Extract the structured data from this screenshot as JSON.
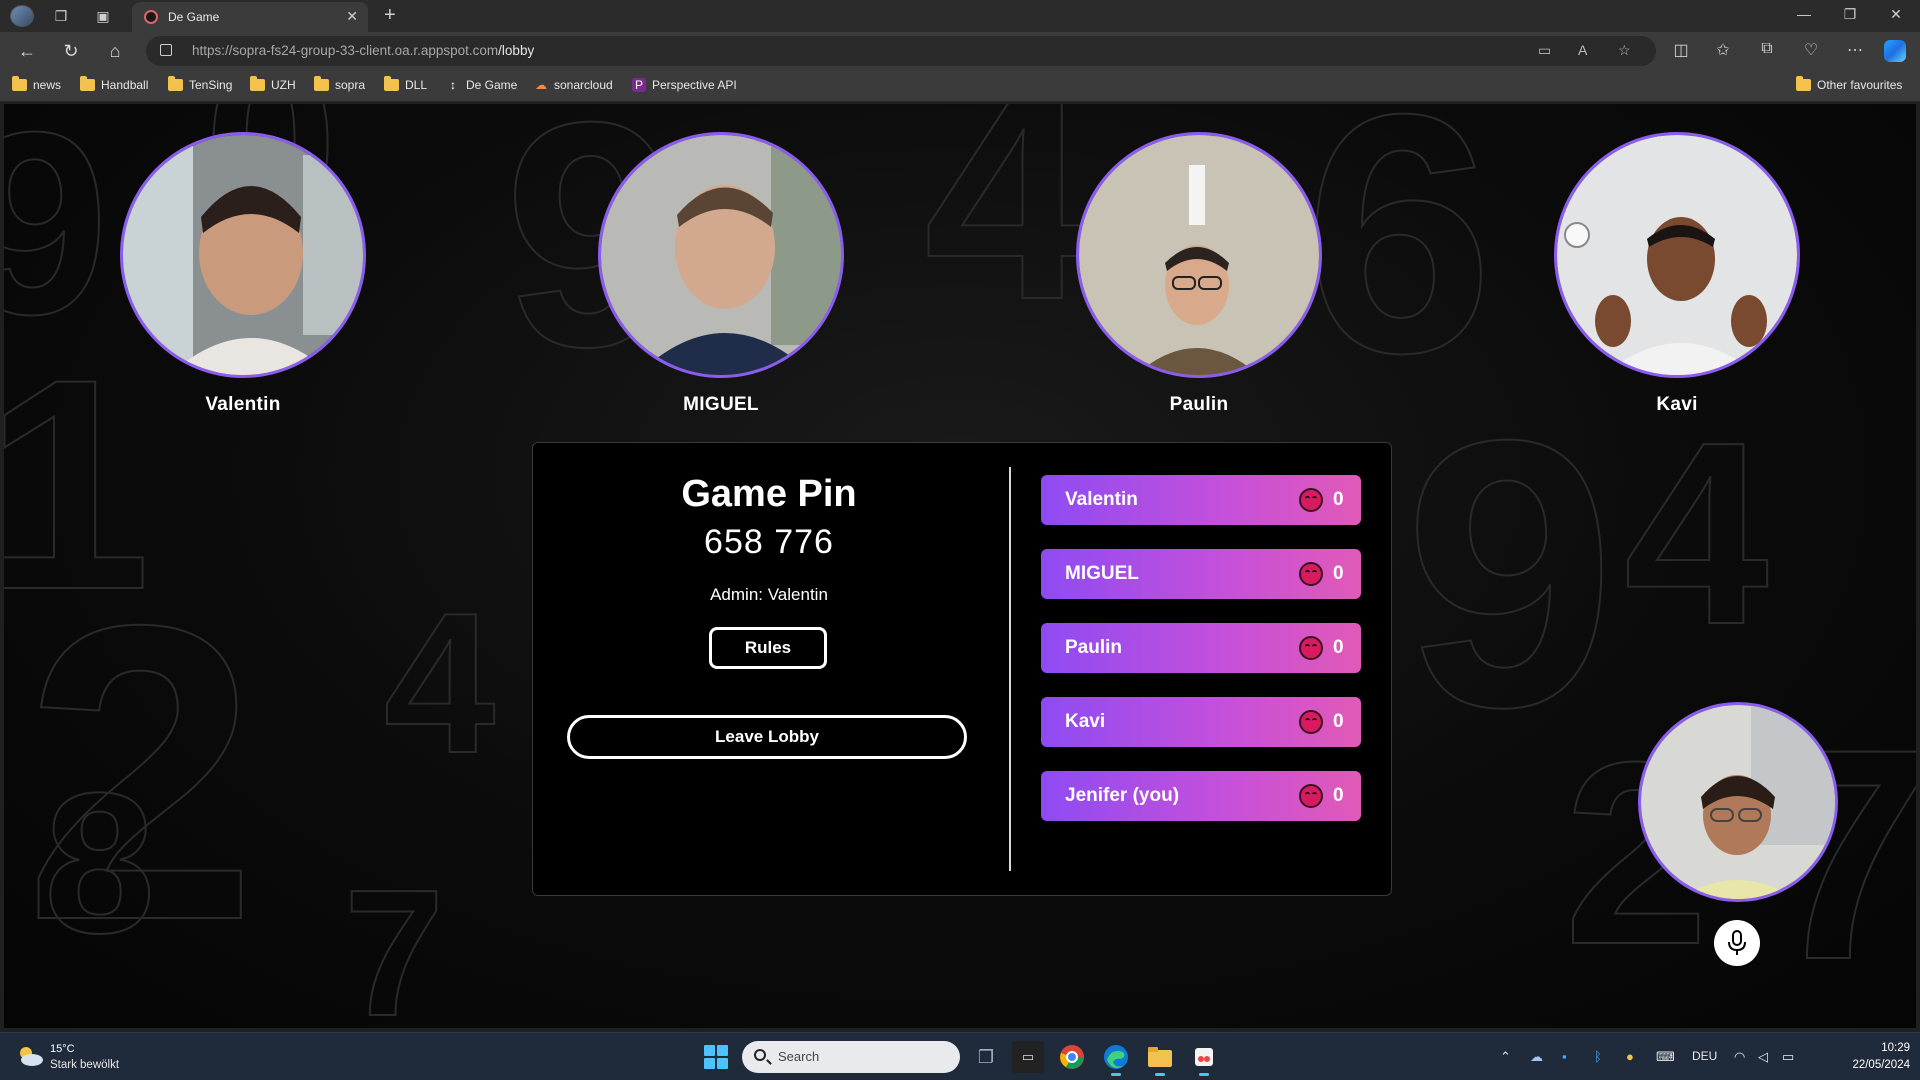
{
  "browser": {
    "tab_title": "De Game",
    "url_host": "https://sopra-fs24-group-33-client.oa.r.appspot.com",
    "url_path": "/lobby",
    "bookmarks": [
      "news",
      "Handball",
      "TenSing",
      "UZH",
      "sopra",
      "DLL",
      "De Game",
      "sonarcloud",
      "Perspective API"
    ],
    "other_favourites": "Other favourites"
  },
  "lobby": {
    "video_tiles": [
      {
        "name": "Valentin"
      },
      {
        "name": "MIGUEL"
      },
      {
        "name": "Paulin"
      },
      {
        "name": "Kavi"
      }
    ],
    "pin_title": "Game Pin",
    "pin_value": "658 776",
    "admin_text": "Admin: Valentin",
    "rules_label": "Rules",
    "leave_label": "Leave Lobby",
    "players": [
      {
        "name": "Valentin",
        "score": "0"
      },
      {
        "name": "MIGUEL",
        "score": "0"
      },
      {
        "name": "Paulin",
        "score": "0"
      },
      {
        "name": "Kavi",
        "score": "0"
      },
      {
        "name": "Jenifer (you)",
        "score": "0"
      }
    ],
    "accent_color": "#8c5cf0"
  },
  "taskbar": {
    "weather_temp": "15°C",
    "weather_desc": "Stark bewölkt",
    "search_placeholder": "Search",
    "language": "DEU",
    "time": "10:29",
    "date": "22/05/2024"
  }
}
